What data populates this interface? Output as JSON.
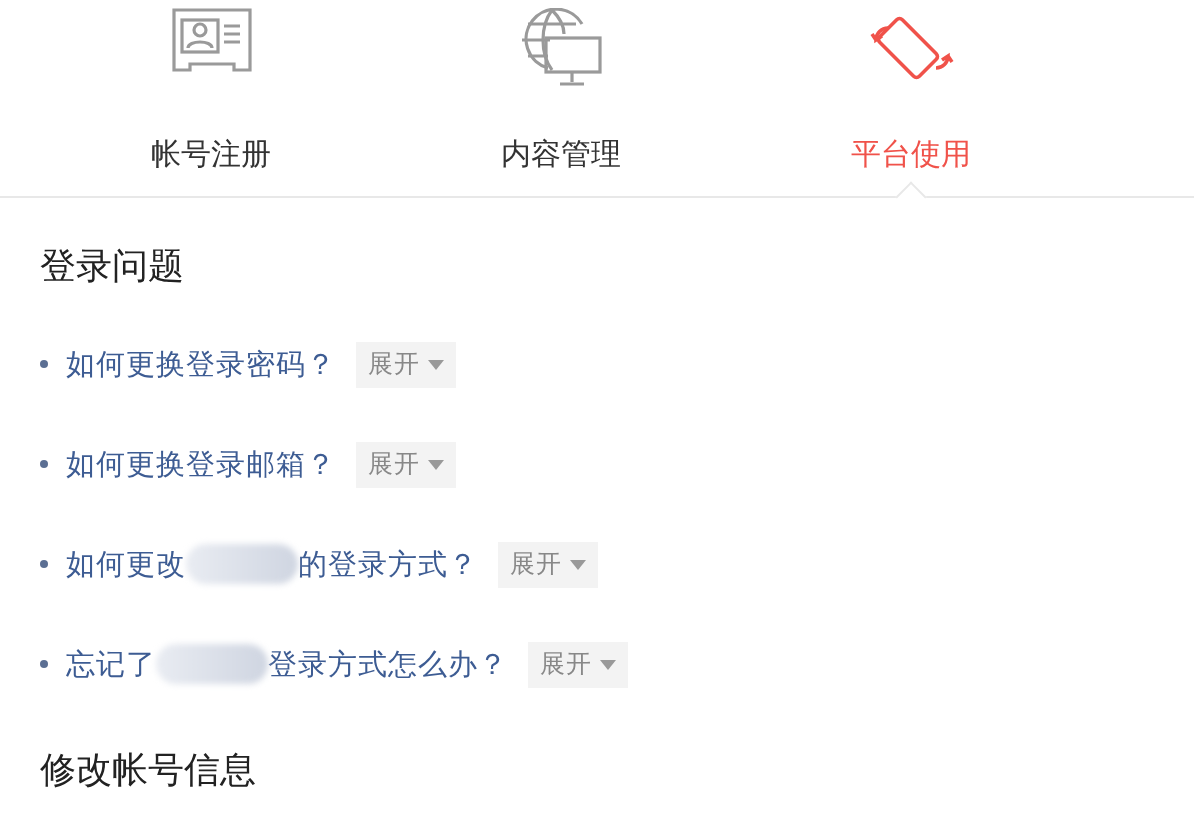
{
  "tabs": [
    {
      "label": "帐号注册",
      "kind": "card",
      "selected": false
    },
    {
      "label": "内容管理",
      "kind": "globe",
      "selected": false
    },
    {
      "label": "平台使用",
      "kind": "rotate",
      "selected": true
    }
  ],
  "sections": [
    {
      "title": "登录问题",
      "questions": [
        {
          "text": "如何更换登录密码？",
          "toggle": "展开"
        },
        {
          "text": "如何更换登录邮箱？",
          "toggle": "展开"
        },
        {
          "text": "如何更改",
          "text_after": "的登录方式？",
          "toggle": "展开"
        },
        {
          "text": "忘记了",
          "text_after": "登录方式怎么办？",
          "toggle": "展开"
        }
      ]
    },
    {
      "title": "修改帐号信息"
    }
  ]
}
